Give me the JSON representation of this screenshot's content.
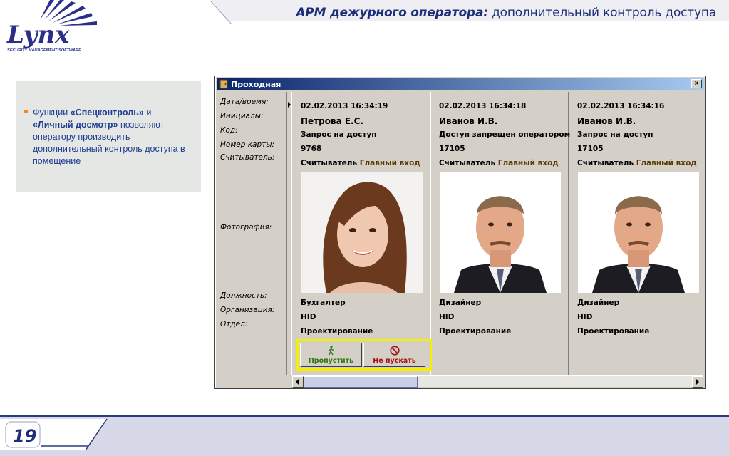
{
  "header": {
    "title_bold": "АРМ дежурного оператора:",
    "title_rest": " дополнительный контроль доступа"
  },
  "logo": {
    "brand": "Lynx",
    "tagline": "SECURITY MANAGEMENT SOFTWARE"
  },
  "info": {
    "t1": "Функции ",
    "b1": "«Спецконтроль»",
    "t2": " и ",
    "b2": "«Личный досмотр»",
    "t3": " позволяют оператору производить дополнительный контроль доступа в помещение"
  },
  "window": {
    "title": "Проходная",
    "close": "×",
    "labels": {
      "datetime": "Дата/время:",
      "initials": "Инициалы:",
      "code": "Код:",
      "card": "Номер карты:",
      "reader": "Считыватель:",
      "photo": "Фотография:",
      "position": "Должность:",
      "org": "Организация:",
      "dept": "Отдел:"
    },
    "cards": [
      {
        "datetime": "02.02.2013 16:34:19",
        "name": "Петрова Е.С.",
        "event": "Запрос на доступ",
        "card": "9768",
        "reader_prefix": "Считыватель ",
        "reader_name": "Главный вход",
        "position": "Бухгалтер",
        "org": "HID",
        "dept": "Проектирование"
      },
      {
        "datetime": "02.02.2013 16:34:18",
        "name": "Иванов И.В.",
        "event": "Доступ запрещен оператором",
        "card": "17105",
        "reader_prefix": "Считыватель ",
        "reader_name": "Главный вход",
        "position": "Дизайнер",
        "org": "HID",
        "dept": "Проектирование"
      },
      {
        "datetime": "02.02.2013 16:34:16",
        "name": "Иванов И.В.",
        "event": "Запрос на доступ",
        "card": "17105",
        "reader_prefix": "Считыватель ",
        "reader_name": "Главный вход",
        "position": "Дизайнер",
        "org": "HID",
        "dept": "Проектирование"
      }
    ],
    "actions": {
      "allow": "Пропустить",
      "deny": "Не пускать"
    }
  },
  "footer": {
    "page": "19"
  },
  "colors": {
    "brand_blue": "#1e2f7a",
    "text_blue": "#1f3c92",
    "bullet": "#f08a1c",
    "highlight": "#f5f000",
    "allow_green": "#2f7a12",
    "deny_red": "#a31212"
  }
}
